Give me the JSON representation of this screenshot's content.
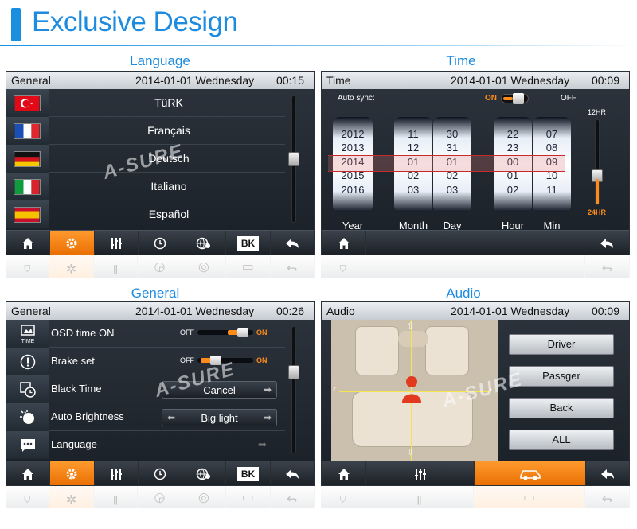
{
  "header": {
    "title": "Exclusive Design"
  },
  "watermark": "A-SURE",
  "common": {
    "date": "2014-01-01 Wednesday",
    "bk_label": "BK"
  },
  "panels": {
    "language": {
      "label": "Language",
      "screen_title": "General",
      "time": "00:15",
      "items": [
        {
          "label": "TüRK",
          "flag": "turkey-flag"
        },
        {
          "label": "Français",
          "flag": "france-flag"
        },
        {
          "label": "Deutsch",
          "flag": "germany-flag"
        },
        {
          "label": "Italiano",
          "flag": "italy-flag"
        },
        {
          "label": "Español",
          "flag": "spain-flag"
        }
      ],
      "scroll_position": 0.75
    },
    "time": {
      "label": "Time",
      "screen_title": "Time",
      "time": "00:09",
      "auto_sync_label": "Auto sync:",
      "on_label": "ON",
      "off_label": "OFF",
      "hr12_label": "12HR",
      "hr24_label": "24HR",
      "columns": [
        {
          "label": "Year",
          "values": [
            "2012",
            "2013",
            "2014",
            "2015",
            "2016"
          ]
        },
        {
          "label": "Month",
          "values": [
            "11",
            "12",
            "01",
            "02",
            "03"
          ]
        },
        {
          "label": "Day",
          "values": [
            "30",
            "31",
            "01",
            "02",
            "03"
          ]
        },
        {
          "label": "Hour",
          "values": [
            "22",
            "23",
            "00",
            "01",
            "02"
          ]
        },
        {
          "label": "Min",
          "values": [
            "07",
            "08",
            "09",
            "10",
            "11"
          ]
        }
      ]
    },
    "general": {
      "label": "General",
      "screen_title": "General",
      "time": "00:26",
      "rows": [
        {
          "label": "OSD time ON",
          "icon": "time-icon",
          "icon_text": "TIME",
          "type": "toggle",
          "off": "OFF",
          "on": "ON",
          "value": "ON"
        },
        {
          "label": "Brake set",
          "icon": "alert-icon",
          "type": "toggle",
          "off": "OFF",
          "on": "ON",
          "value": "OFF"
        },
        {
          "label": "Black Time",
          "icon": "clock-window-icon",
          "type": "select",
          "value": "Cancel"
        },
        {
          "label": "Auto Brightness",
          "icon": "brightness-icon",
          "type": "select",
          "value": "Big light"
        },
        {
          "label": "Language",
          "icon": "chat-icon",
          "type": "link"
        }
      ]
    },
    "audio": {
      "label": "Audio",
      "screen_title": "Audio",
      "time": "00:09",
      "buttons": [
        "Driver",
        "Passger",
        "Back",
        "ALL"
      ]
    }
  },
  "nav": {
    "full": [
      "home-icon",
      "settings-icon",
      "equalizer-icon",
      "clock-icon",
      "globe-settings-icon",
      "bk-button",
      "back-arrow-icon"
    ],
    "time": [
      "home-icon",
      "back-arrow-icon"
    ],
    "audio": [
      "home-icon",
      "equalizer-icon",
      "car-icon",
      "back-arrow-icon"
    ]
  },
  "colors": {
    "accent": "#1d8be0",
    "active_tab": "#f08a1c",
    "on_text": "#ff8c1a"
  }
}
